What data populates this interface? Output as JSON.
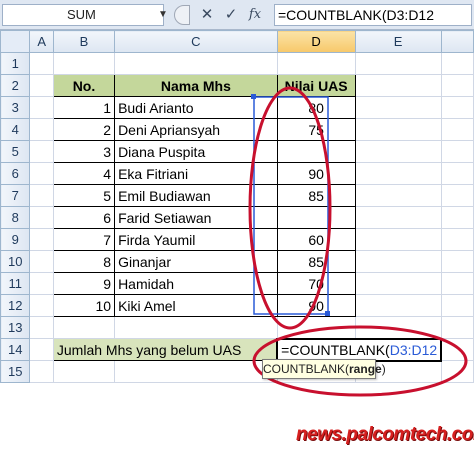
{
  "formula_bar": {
    "name_box": "SUM",
    "dropdown_icon": "chevron-down-icon",
    "cancel_icon": "✕",
    "enter_icon": "✓",
    "function_label": "fx",
    "formula_prefix": "=COUNTBLANK(",
    "formula_range": "D3:D12"
  },
  "columns": [
    "A",
    "B",
    "C",
    "D",
    "E"
  ],
  "rows": [
    "1",
    "2",
    "3",
    "4",
    "5",
    "6",
    "7",
    "8",
    "9",
    "10",
    "11",
    "12",
    "13",
    "14",
    "15"
  ],
  "table": {
    "headers": {
      "no": "No.",
      "name": "Nama Mhs",
      "score": "Nilai UAS"
    },
    "students": [
      {
        "no": "1",
        "name": "Budi Arianto",
        "score": "80"
      },
      {
        "no": "2",
        "name": "Deni Apriansyah",
        "score": "75"
      },
      {
        "no": "3",
        "name": "Diana Puspita",
        "score": ""
      },
      {
        "no": "4",
        "name": "Eka Fitriani",
        "score": "90"
      },
      {
        "no": "5",
        "name": "Emil Budiawan",
        "score": "85"
      },
      {
        "no": "6",
        "name": "Farid Setiawan",
        "score": ""
      },
      {
        "no": "7",
        "name": "Firda Yaumil",
        "score": "60"
      },
      {
        "no": "8",
        "name": "Ginanjar",
        "score": "85"
      },
      {
        "no": "9",
        "name": "Hamidah",
        "score": "70"
      },
      {
        "no": "10",
        "name": "Kiki Amel",
        "score": "90"
      }
    ],
    "summary_label": "Jumlah Mhs yang belum UAS",
    "active_cell_prefix": "=COUNTBLANK(",
    "active_cell_range": "D3:D12"
  },
  "tooltip": {
    "func": "COUNTBLANK(",
    "arg": "range",
    "close": ")"
  },
  "watermark": "news.palcomtech.com",
  "colors": {
    "header_green": "#c4d79b",
    "label_green": "#d8e4bc",
    "annotation_red": "#c8102e",
    "range_blue": "#2a5bd7",
    "watermark_red": "#d62020"
  }
}
